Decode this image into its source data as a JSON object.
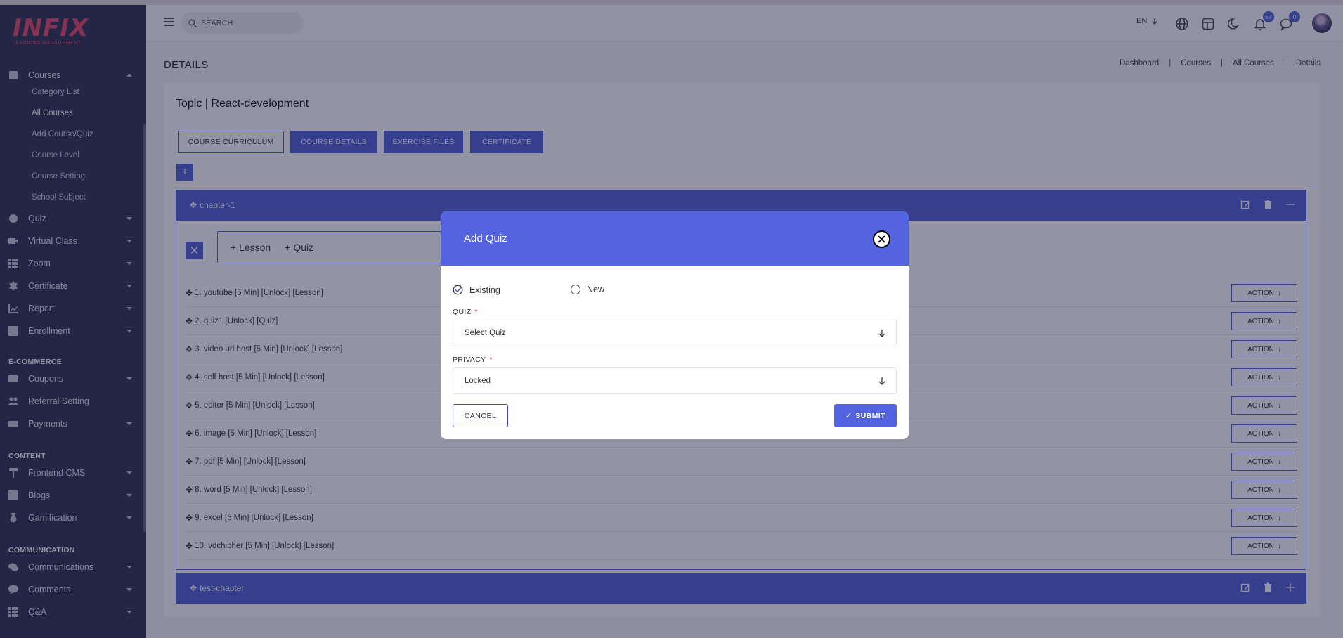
{
  "brand": {
    "logo_text": "INFIX",
    "logo_sub": "LEARNING MANAGEMENT"
  },
  "sidebar": {
    "courses": {
      "label": "Courses",
      "subitems": [
        "Category List",
        "All Courses",
        "Add Course/Quiz",
        "Course Level",
        "Course Setting",
        "School Subject"
      ]
    },
    "items": [
      {
        "label": "Quiz",
        "icon": "question-circle-icon"
      },
      {
        "label": "Virtual Class",
        "icon": "video-icon"
      },
      {
        "label": "Zoom",
        "icon": "grid-icon"
      },
      {
        "label": "Certificate",
        "icon": "badge-icon"
      },
      {
        "label": "Report",
        "icon": "chart-icon"
      },
      {
        "label": "Enrollment",
        "icon": "enroll-icon"
      }
    ],
    "section_ecommerce": "E-COMMERCE",
    "ecommerce": [
      {
        "label": "Coupons",
        "icon": "coupon-icon"
      },
      {
        "label": "Referral Setting",
        "icon": "users-icon"
      },
      {
        "label": "Payments",
        "icon": "money-icon"
      }
    ],
    "section_content": "CONTENT",
    "content": [
      {
        "label": "Frontend CMS",
        "icon": "paint-roller-icon"
      },
      {
        "label": "Blogs",
        "icon": "edit-icon"
      },
      {
        "label": "Gamification",
        "icon": "medal-icon"
      }
    ],
    "section_communication": "COMMUNICATION",
    "communication": [
      {
        "label": "Communications",
        "icon": "chat-icon"
      },
      {
        "label": "Comments",
        "icon": "comment-icon"
      },
      {
        "label": "Q&A",
        "icon": "grid-icon"
      }
    ]
  },
  "header": {
    "search_placeholder": "SEARCH",
    "lang": "EN",
    "notifications_count": "57",
    "messages_count": "0"
  },
  "page": {
    "title": "DETAILS",
    "breadcrumb": [
      "Dashboard",
      "Courses",
      "All Courses",
      "Details"
    ],
    "topic_title": "Topic | React-development",
    "tabs": [
      "COURSE CURRICULUM",
      "COURSE DETAILS",
      "EXERCISE FILES",
      "CERTIFICATE"
    ]
  },
  "chapters": [
    {
      "name": "chapter-1"
    },
    {
      "name": "test-chapter"
    }
  ],
  "add_box": {
    "lesson": "Lesson",
    "quiz": "Quiz"
  },
  "lessons": [
    "1. youtube [5 Min] [Unlock] [Lesson]",
    "2. quiz1 [Unlock] [Quiz]",
    "3. video url host [5 Min] [Unlock] [Lesson]",
    "4. self host [5 Min] [Unlock] [Lesson]",
    "5. editor [5 Min] [Unlock] [Lesson]",
    "6. image [5 Min] [Unlock] [Lesson]",
    "7. pdf [5 Min] [Unlock] [Lesson]",
    "8. word [5 Min] [Unlock] [Lesson]",
    "9. excel [5 Min] [Unlock] [Lesson]",
    "10. vdchipher [5 Min] [Unlock] [Lesson]"
  ],
  "action_label": "ACTION",
  "modal": {
    "title": "Add Quiz",
    "option_existing": "Existing",
    "option_new": "New",
    "quiz_label": "QUIZ",
    "quiz_value": "Select Quiz",
    "privacy_label": "PRIVACY",
    "privacy_value": "Locked",
    "required_mark": "*",
    "cancel": "CANCEL",
    "submit": "SUBMIT"
  },
  "colors": {
    "primary": "#4e5fd6",
    "sidebar": "#2c2e4c",
    "logo": "#e8466a"
  }
}
